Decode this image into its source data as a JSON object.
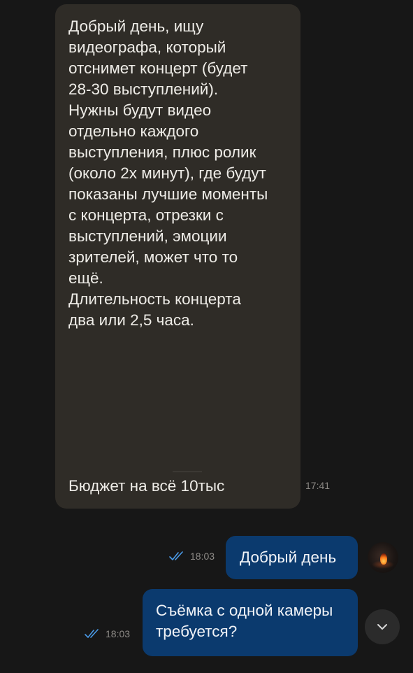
{
  "chat": {
    "incoming": {
      "text": "Добрый день, ищу\nвидеографа, который\nотснимет концерт (будет\n28-30 выступлений).\nНужны будут видео\nотдельно каждого\nвыступления, плюс ролик\n(около 2х минут), где будут\nпоказаны лучшие моменты\nс концерта, отрезки с\nвыступлений, эмоции\nзрителей, может что то\nещё.\nДлительность концерта\nдва или 2,5 часа.",
      "last_line": "Бюджет на всё 10тыс",
      "time": "17:41"
    },
    "outgoing": [
      {
        "text": "Добрый день",
        "time": "18:03",
        "status_icon": "double-check-icon"
      },
      {
        "text": "Съёмка с одной камеры\nтребуется?",
        "time": "18:03",
        "status_icon": "double-check-icon"
      }
    ],
    "avatar_icon": "user-avatar",
    "scroll_icon": "chevron-down-icon"
  },
  "colors": {
    "background": "#171717",
    "incoming_bubble": "#2f2c27",
    "outgoing_bubble": "#0b3a6e",
    "check_color": "#4a9be8",
    "meta_text": "#8f8c88"
  }
}
